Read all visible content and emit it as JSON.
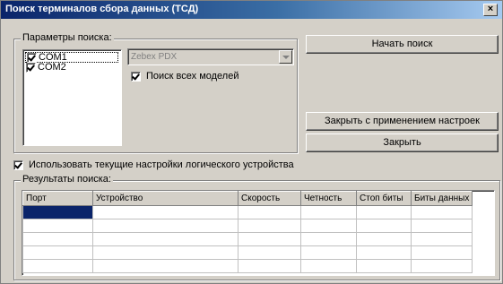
{
  "window": {
    "title": "Поиск терминалов сбора данных (ТСД)",
    "close_glyph": "×"
  },
  "search_params": {
    "label": "Параметры поиска:",
    "ports": [
      {
        "label": "COM1",
        "checked": true,
        "focused": true
      },
      {
        "label": "COM2",
        "checked": true,
        "focused": false
      }
    ],
    "model_combo": {
      "value": "Zebex PDX",
      "disabled": true
    },
    "search_all_models": {
      "label": "Поиск всех моделей",
      "checked": true
    }
  },
  "buttons": {
    "start_search": "Начать поиск",
    "close_apply": "Закрыть с применением настроек",
    "close": "Закрыть"
  },
  "use_current_settings": {
    "label": "Использовать текущие настройки логического устройства",
    "checked": true
  },
  "results": {
    "label": "Результаты поиска:",
    "columns": [
      "Порт",
      "Устройство",
      "Скорость",
      "Четность",
      "Стоп биты",
      "Биты данных"
    ],
    "rows": [
      [
        "",
        "",
        "",
        "",
        "",
        ""
      ],
      [
        "",
        "",
        "",
        "",
        "",
        ""
      ],
      [
        "",
        "",
        "",
        "",
        "",
        ""
      ],
      [
        "",
        "",
        "",
        "",
        "",
        ""
      ],
      [
        "",
        "",
        "",
        "",
        "",
        ""
      ]
    ]
  }
}
